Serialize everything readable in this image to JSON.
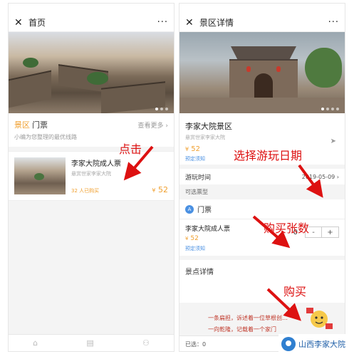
{
  "left": {
    "nav_title": "首页",
    "close_glyph": "✕",
    "more_glyph": "···",
    "section_tag": "景区",
    "section_title": "门票",
    "section_link": "查看更多 ›",
    "subtitle": "小编为您整理的最优线路",
    "card": {
      "name": "李家大院成人票",
      "desc": "悬赏世家李家大院",
      "sold": "32 人已购买",
      "price_symbol": "¥",
      "price": "52"
    },
    "tab_icons": [
      "home-icon",
      "list-icon",
      "user-icon"
    ],
    "tab_glyphs": [
      "⌂",
      "▤",
      "⚇"
    ]
  },
  "right": {
    "nav_title": "景区详情",
    "close_glyph": "✕",
    "more_glyph": "···",
    "scenic_name": "李家大院景区",
    "scenic_desc": "悬赏世家李家大院",
    "price_symbol": "¥",
    "price": "52",
    "notice": "预定须知",
    "visit_label": "游玩时间",
    "visit_date": "2019-05-09 ›",
    "ticket_type_label": "可选票型",
    "ticket_group": "门票",
    "ticket_group_badge": "A",
    "ticket": {
      "name": "李家大院成人票",
      "price_symbol": "¥",
      "price": "52",
      "notice": "预定须知",
      "qty": "0",
      "minus": "-",
      "plus": "+"
    },
    "scenic_detail_title": "景点详情",
    "scenic_lines": [
      "一条扁担，诉述着一位草根创…",
      "一向乾隆，记载着一个家门"
    ],
    "selected_label": "已选：0"
  },
  "annotations": {
    "click": "点击",
    "choose_date": "选择游玩日期",
    "buy_count": "购买张数",
    "buy": "购买"
  },
  "logo": {
    "text": "山西李家大院"
  },
  "colors": {
    "accent": "#f0a030",
    "link": "#4a90e2",
    "annotation": "#dd1111"
  }
}
